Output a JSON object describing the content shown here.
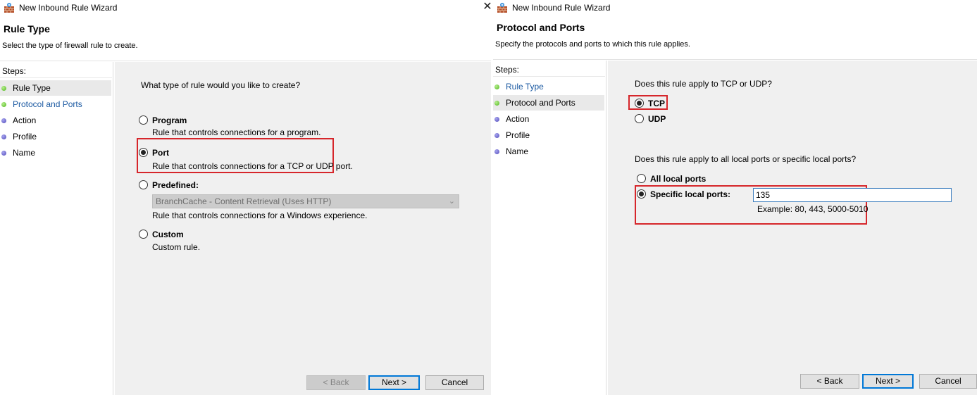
{
  "wizard1": {
    "title": "New Inbound Rule Wizard",
    "heading": "Rule Type",
    "subtitle": "Select the type of firewall rule to create.",
    "steps_title": "Steps:",
    "steps": [
      {
        "label": "Rule Type",
        "state": "current"
      },
      {
        "label": "Protocol and Ports",
        "state": "link"
      },
      {
        "label": "Action",
        "state": "pending"
      },
      {
        "label": "Profile",
        "state": "pending"
      },
      {
        "label": "Name",
        "state": "pending"
      }
    ],
    "question": "What type of rule would you like to create?",
    "options": [
      {
        "label": "Program",
        "desc": "Rule that controls connections for a program.",
        "checked": false
      },
      {
        "label": "Port",
        "desc": "Rule that controls connections for a TCP or UDP port.",
        "checked": true
      },
      {
        "label": "Predefined:",
        "desc": "Rule that controls connections for a Windows experience.",
        "checked": false
      },
      {
        "label": "Custom",
        "desc": "Custom rule.",
        "checked": false
      }
    ],
    "predefined_value": "BranchCache - Content Retrieval (Uses HTTP)",
    "buttons": {
      "back": "< Back",
      "next": "Next >",
      "cancel": "Cancel"
    }
  },
  "wizard2": {
    "title": "New Inbound Rule Wizard",
    "close_glyph": "✕",
    "heading": "Protocol and Ports",
    "subtitle": "Specify the protocols and ports to which this rule applies.",
    "steps_title": "Steps:",
    "steps": [
      {
        "label": "Rule Type",
        "state": "link"
      },
      {
        "label": "Protocol and Ports",
        "state": "current"
      },
      {
        "label": "Action",
        "state": "pending"
      },
      {
        "label": "Profile",
        "state": "pending"
      },
      {
        "label": "Name",
        "state": "pending"
      }
    ],
    "protocol_question": "Does this rule apply to TCP or UDP?",
    "protocol_options": [
      {
        "label": "TCP",
        "checked": true
      },
      {
        "label": "UDP",
        "checked": false
      }
    ],
    "ports_question": "Does this rule apply to all local ports or specific local ports?",
    "ports_options": [
      {
        "label": "All local ports",
        "checked": false
      },
      {
        "label": "Specific local ports:",
        "checked": true
      }
    ],
    "ports_value": "135",
    "ports_example": "Example: 80, 443, 5000-5010",
    "buttons": {
      "back": "< Back",
      "next": "Next >",
      "cancel": "Cancel"
    }
  },
  "colors": {
    "highlight": "#d6262b",
    "link": "#1c5aa2",
    "step_done": "#4fb51c",
    "step_pending": "#4f49b9"
  }
}
